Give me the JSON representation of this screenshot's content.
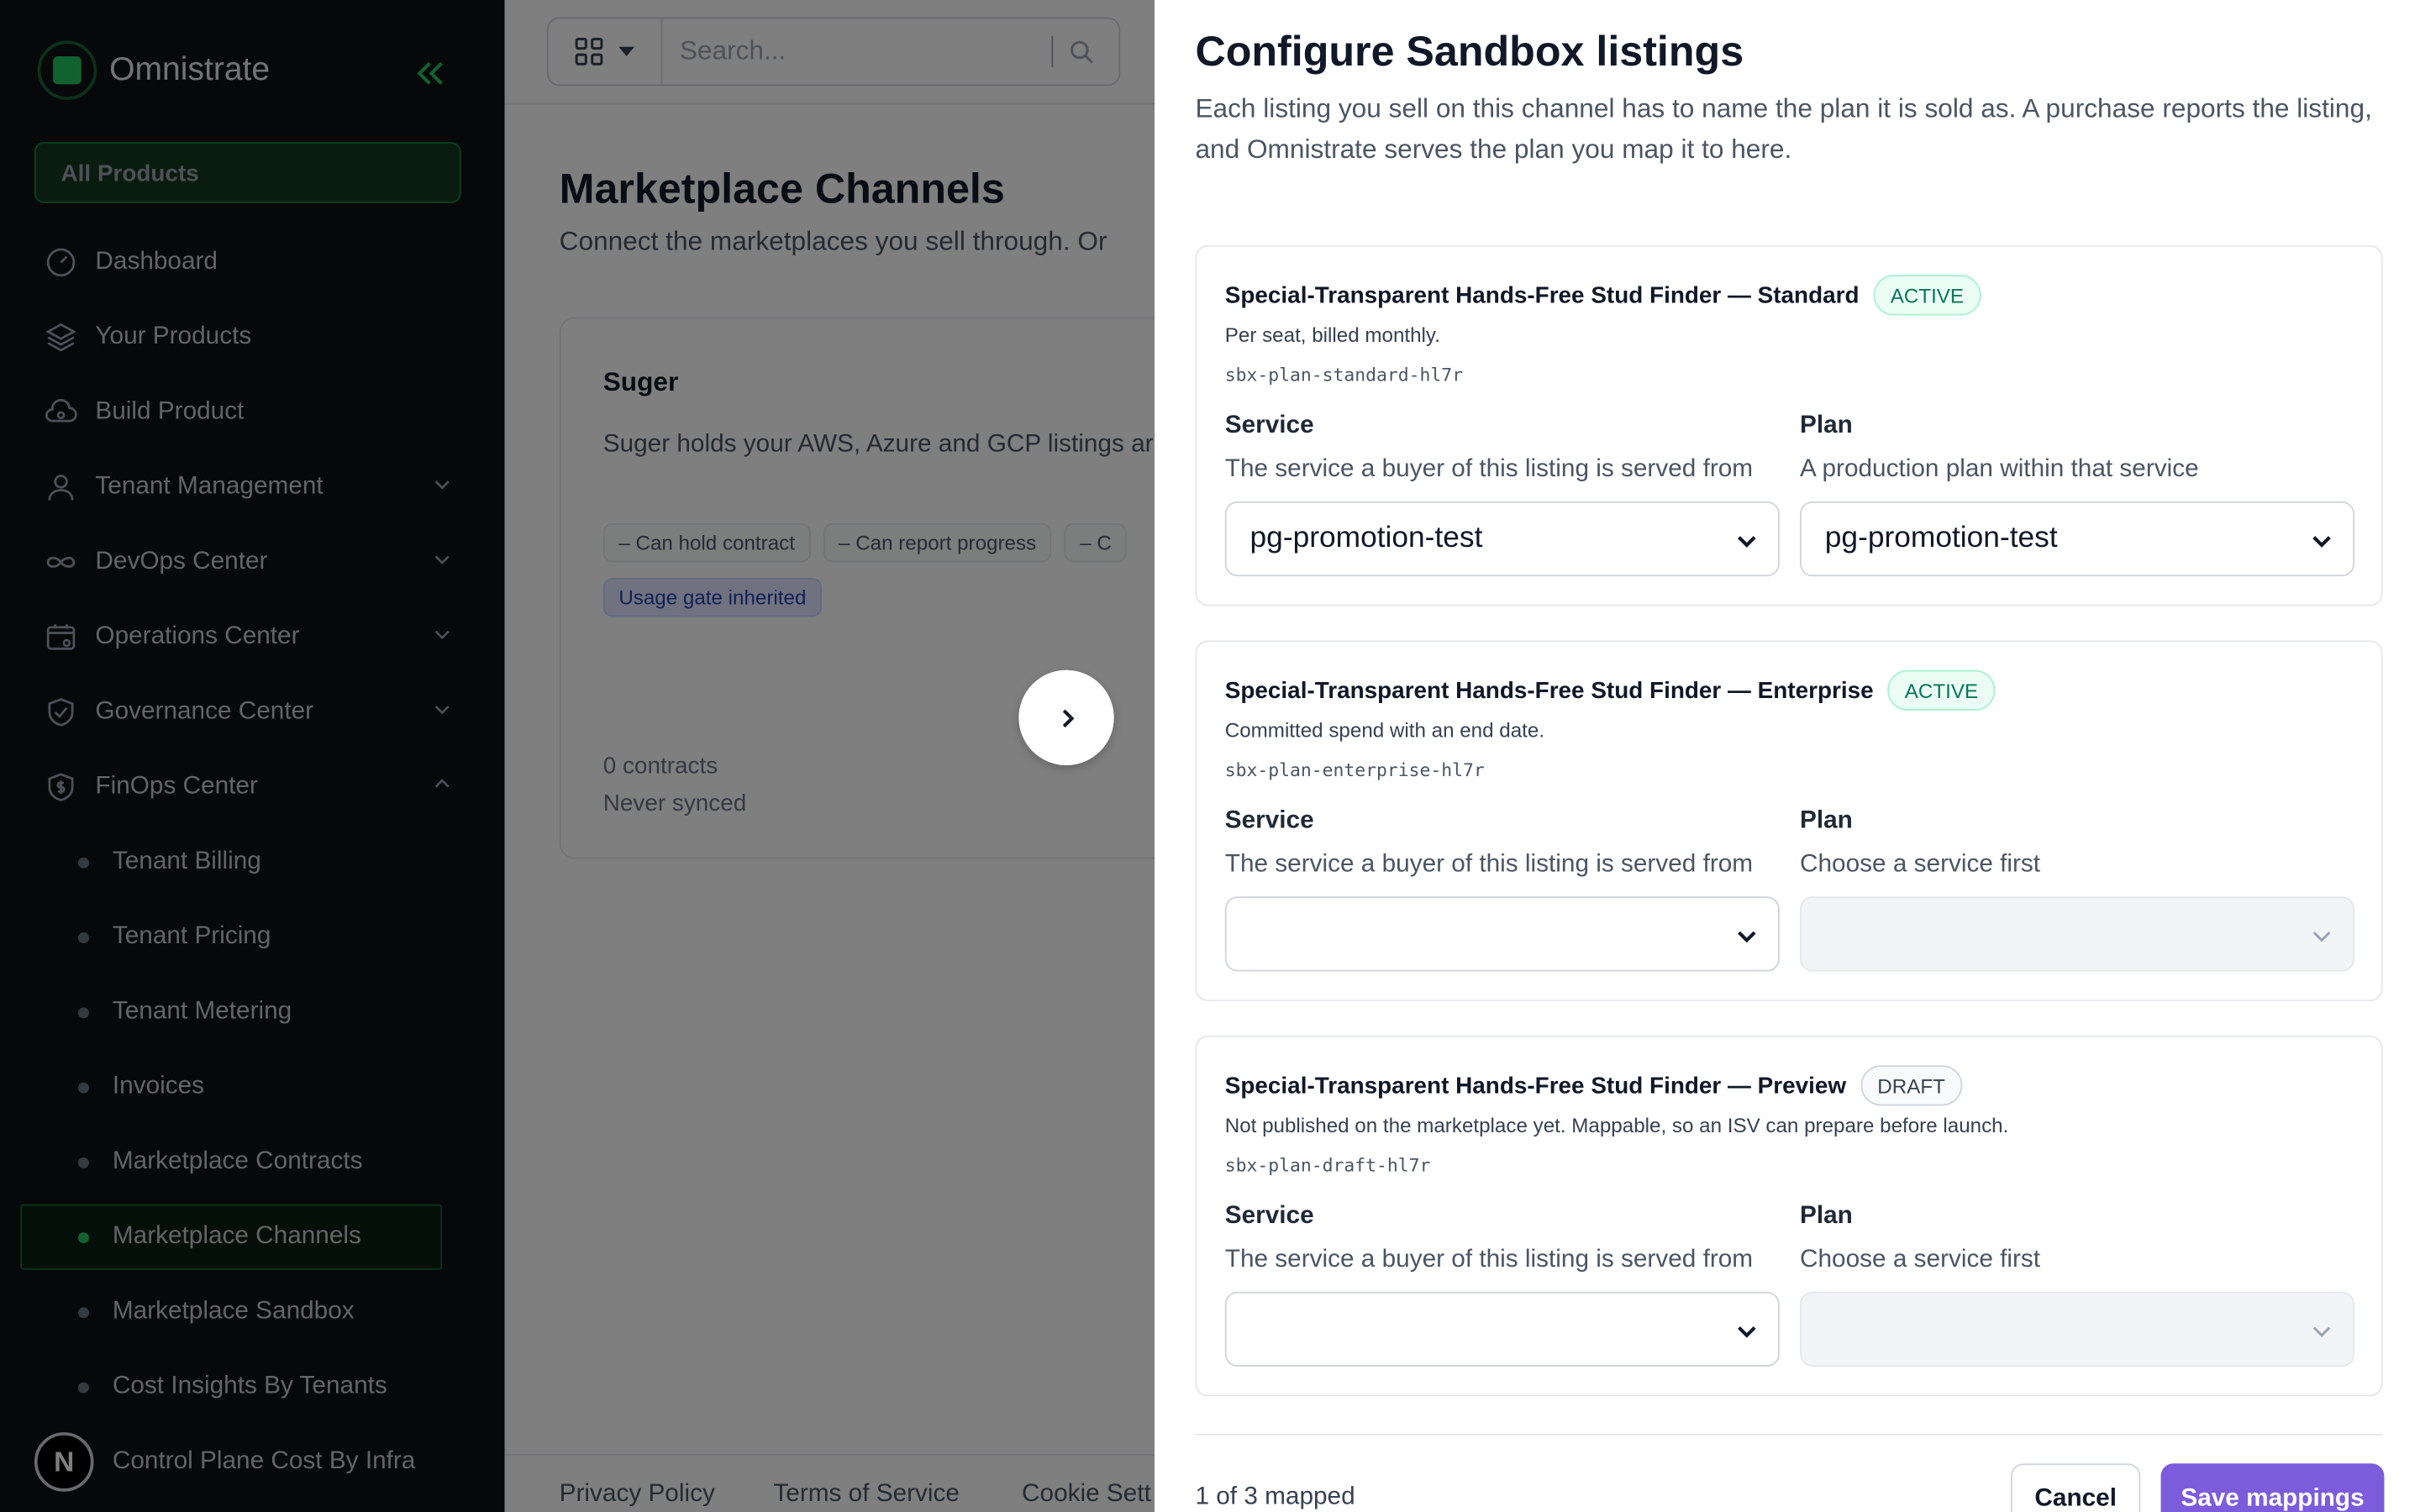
{
  "sidebar": {
    "brand": "Omnistrate",
    "all_products": "All Products",
    "items": [
      {
        "label": "Dashboard",
        "icon": "gauge-icon"
      },
      {
        "label": "Your Products",
        "icon": "layers-icon"
      },
      {
        "label": "Build Product",
        "icon": "cloud-gear-icon"
      },
      {
        "label": "Tenant Management",
        "icon": "user-icon"
      },
      {
        "label": "DevOps Center",
        "icon": "infinity-icon"
      },
      {
        "label": "Operations Center",
        "icon": "calendar-gear-icon"
      },
      {
        "label": "Governance Center",
        "icon": "shield-check-icon"
      },
      {
        "label": "FinOps Center",
        "icon": "shield-dollar-icon"
      }
    ],
    "sub_items": [
      {
        "label": "Tenant Billing"
      },
      {
        "label": "Tenant Pricing"
      },
      {
        "label": "Tenant Metering"
      },
      {
        "label": "Invoices"
      },
      {
        "label": "Marketplace Contracts"
      },
      {
        "label": "Marketplace Channels"
      },
      {
        "label": "Marketplace Sandbox"
      },
      {
        "label": "Cost Insights By Tenants"
      },
      {
        "label": "Control Plane Cost By Infra"
      }
    ],
    "avatar_initial": "N",
    "accent": "#22c55e"
  },
  "main": {
    "search_placeholder": "Search...",
    "title": "Marketplace Channels",
    "subtitle": "Connect the marketplaces you sell through. Or",
    "channel": {
      "name": "Suger",
      "description": "Suger holds your AWS, Azure and GCP listings ar entitlement shape.",
      "chips": [
        "Can hold contract",
        "Can report progress",
        "C"
      ],
      "chip_inherited": "Usage gate inherited",
      "contracts": "0 contracts",
      "synced": "Never synced"
    },
    "footer": [
      "Privacy Policy",
      "Terms of Service",
      "Cookie Sett"
    ]
  },
  "drawer": {
    "title": "Configure Sandbox listings",
    "description": "Each listing you sell on this channel has to name the plan it is sold as. A purchase reports the listing, and Omnistrate serves the plan you map it to here.",
    "service_label": "Service",
    "plan_label": "Plan",
    "service_help": "The service a buyer of this listing is served from",
    "listings": [
      {
        "name": "Special-Transparent Hands-Free Stud Finder — Standard",
        "status": "ACTIVE",
        "note": "Per seat, billed monthly.",
        "code": "sbx-plan-standard-hl7r",
        "plan_help": "A production plan within that service",
        "service_value": "pg-promotion-test",
        "plan_value": "pg-promotion-test"
      },
      {
        "name": "Special-Transparent Hands-Free Stud Finder — Enterprise",
        "status": "ACTIVE",
        "note": "Committed spend with an end date.",
        "code": "sbx-plan-enterprise-hl7r",
        "plan_help": "Choose a service first",
        "service_value": "",
        "plan_value": ""
      },
      {
        "name": "Special-Transparent Hands-Free Stud Finder — Preview",
        "status": "DRAFT",
        "note": "Not published on the marketplace yet. Mappable, so an ISV can prepare before launch.",
        "code": "sbx-plan-draft-hl7r",
        "plan_help": "Choose a service first",
        "service_value": "",
        "plan_value": ""
      }
    ],
    "mapped_status": "1 of 3 mapped",
    "cancel": "Cancel",
    "save": "Save mappings",
    "save_color": "#7c5cdb"
  }
}
